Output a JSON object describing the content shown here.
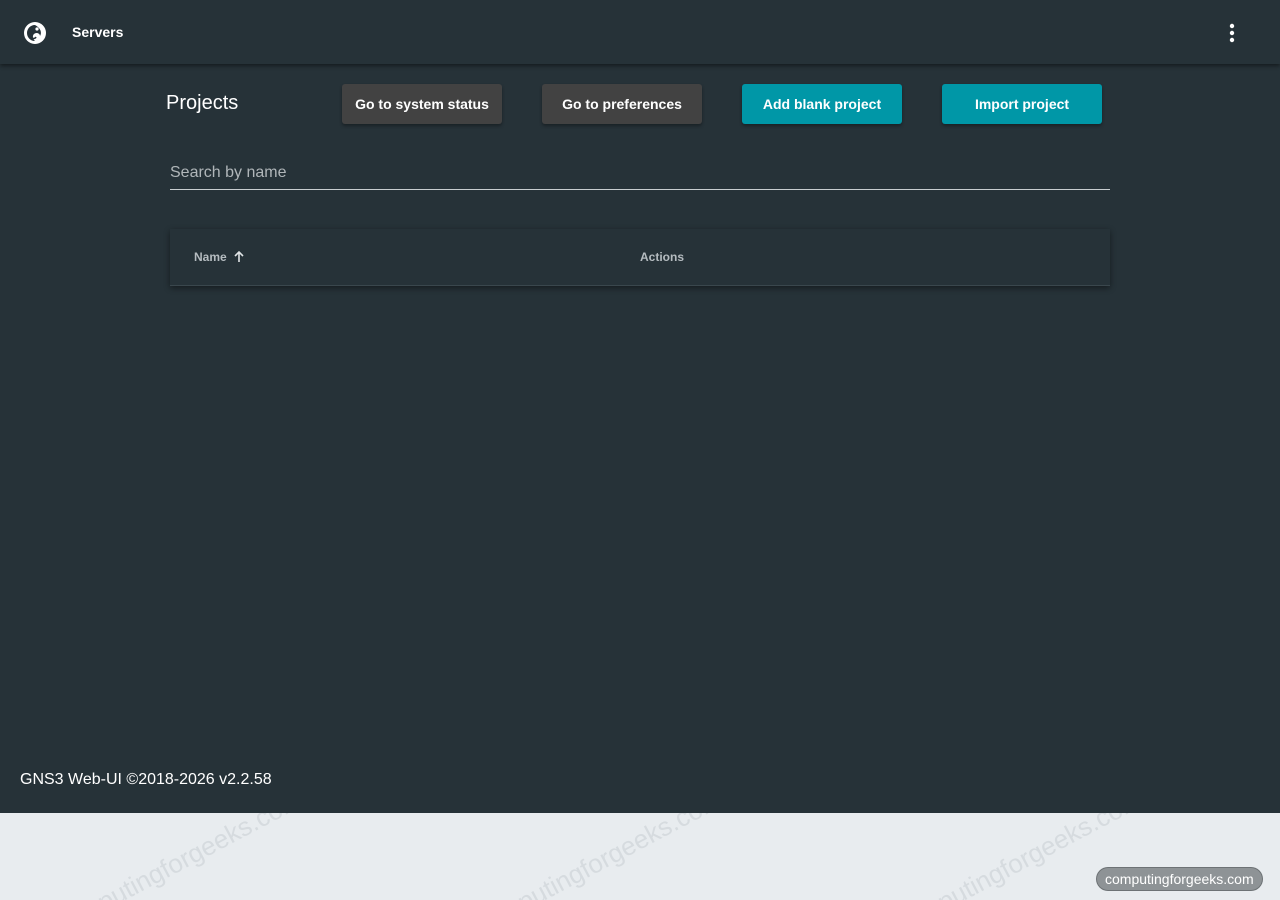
{
  "header": {
    "logo_icon": "gns3-chameleon-icon",
    "servers_label": "Servers",
    "menu_icon": "more-vert-icon"
  },
  "main": {
    "title": "Projects",
    "buttons": {
      "system_status": "Go to system status",
      "preferences": "Go to preferences",
      "add_blank": "Add blank project",
      "import": "Import project"
    },
    "search": {
      "placeholder": "Search by name",
      "value": ""
    },
    "table": {
      "columns": [
        "Name",
        "Actions"
      ],
      "sort_icon": "arrow-up-icon",
      "rows": []
    }
  },
  "footer": {
    "text": "GNS3 Web-UI ©2018-2026 v2.2.58"
  },
  "watermark": {
    "text": "computingforgeeks.com"
  },
  "colors": {
    "background": "#263238",
    "accent": "#0097a7",
    "secondary_button": "#424242",
    "page_outside": "#e8ecef"
  }
}
